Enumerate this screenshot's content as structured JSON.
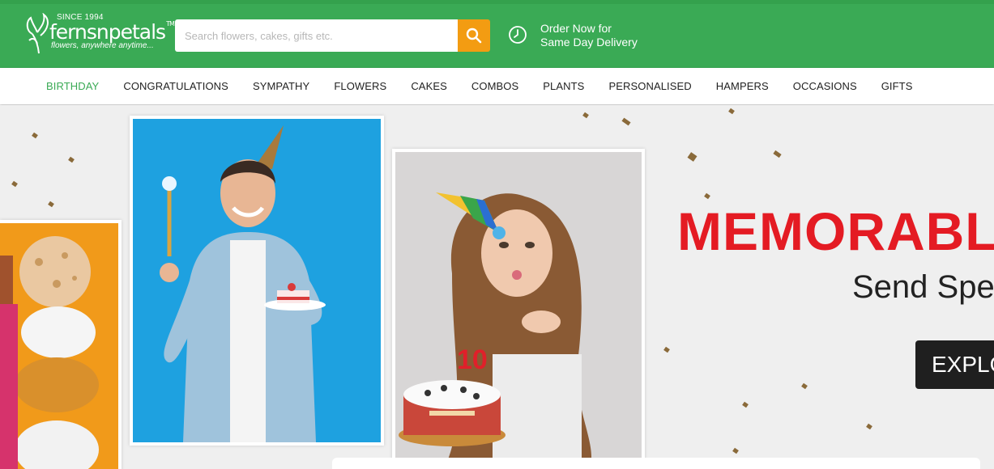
{
  "header": {
    "logo": {
      "since": "SINCE 1994",
      "brand": "fernsnpetals",
      "tm": "TM",
      "tagline": "flowers, anywhere anytime..."
    },
    "search": {
      "placeholder": "Search flowers, cakes, gifts etc.",
      "value": ""
    },
    "search_icon": "search-icon",
    "delivery": {
      "line1": "Order Now for",
      "line2": "Same Day Delivery",
      "icon": "clock-icon"
    },
    "colors": {
      "header_bg": "#3aaa55",
      "search_button": "#f39c12"
    }
  },
  "nav": {
    "items": [
      {
        "label": "BIRTHDAY",
        "active": true
      },
      {
        "label": "CONGRATULATIONS"
      },
      {
        "label": "SYMPATHY"
      },
      {
        "label": "FLOWERS"
      },
      {
        "label": "CAKES"
      },
      {
        "label": "COMBOS"
      },
      {
        "label": "PLANTS"
      },
      {
        "label": "PERSONALISED"
      },
      {
        "label": "HAMPERS"
      },
      {
        "label": "OCCASIONS"
      },
      {
        "label": "GIFTS"
      }
    ],
    "active_color": "#3aaa55"
  },
  "banner": {
    "headline": "MEMORABL",
    "subline": "Send Spec",
    "cta": "EXPLO",
    "cake_number": "10",
    "headline_color": "#e41b23"
  }
}
